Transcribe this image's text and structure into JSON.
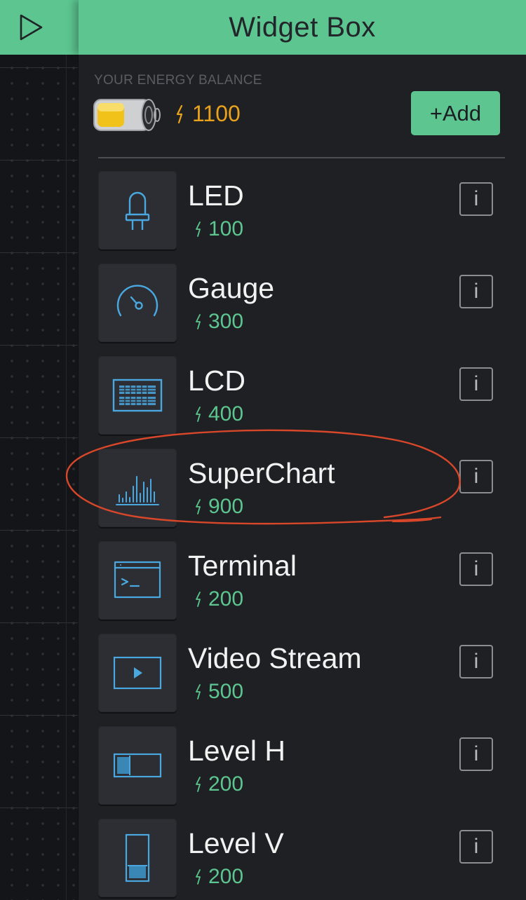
{
  "header": {
    "title": "Widget Box",
    "play_icon": "play-icon"
  },
  "energy": {
    "label": "YOUR ENERGY BALANCE",
    "balance": "1100",
    "add_label": "+Add",
    "battery_icon": "battery-icon",
    "bolt_color": "#e8a21b"
  },
  "widgets": [
    {
      "name": "LED",
      "cost": "100",
      "icon": "led-icon",
      "info": "i"
    },
    {
      "name": "Gauge",
      "cost": "300",
      "icon": "gauge-icon",
      "info": "i"
    },
    {
      "name": "LCD",
      "cost": "400",
      "icon": "lcd-icon",
      "info": "i"
    },
    {
      "name": "SuperChart",
      "cost": "900",
      "icon": "superchart-icon",
      "info": "i"
    },
    {
      "name": "Terminal",
      "cost": "200",
      "icon": "terminal-icon",
      "info": "i"
    },
    {
      "name": "Video Stream",
      "cost": "500",
      "icon": "video-stream-icon",
      "info": "i"
    },
    {
      "name": "Level H",
      "cost": "200",
      "icon": "level-h-icon",
      "info": "i"
    },
    {
      "name": "Level V",
      "cost": "200",
      "icon": "level-v-icon",
      "info": "i"
    }
  ],
  "colors": {
    "accent": "#5cc590",
    "icon_blue": "#4aa8e0",
    "annotation_red": "#d9472b",
    "panel_bg": "#1f2023"
  }
}
